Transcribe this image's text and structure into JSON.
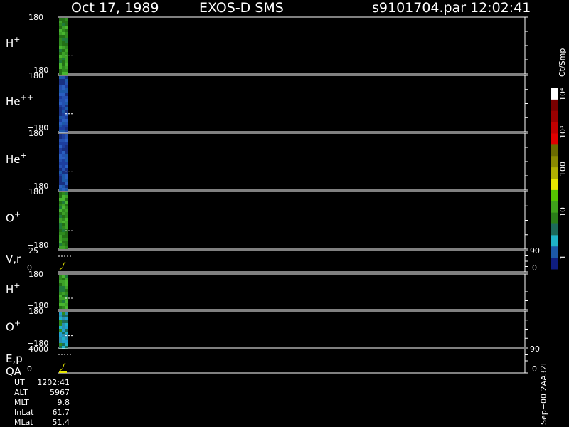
{
  "header": {
    "date": "Oct 17, 1989",
    "title": "EXOS-D SMS",
    "file": "s9101704.par",
    "time": "12:02:41"
  },
  "colors": {
    "background": "#000000",
    "frame": "#ffffff",
    "green": "#2e8a1e",
    "blue": "#1d3e9e",
    "cyan": "#1fb3c8",
    "yellow": "#e6e600"
  },
  "chart_data": {
    "type": "heatmap",
    "panels": [
      {
        "label": "H",
        "sup": "+",
        "tick_top": "180",
        "tick_bottom": "−180",
        "dominant": "green"
      },
      {
        "label": "He",
        "sup": "++",
        "tick_top": "180",
        "tick_bottom": "−180",
        "dominant": "blue"
      },
      {
        "label": "He",
        "sup": "+",
        "tick_top": "180",
        "tick_bottom": "−180",
        "dominant": "blue"
      },
      {
        "label": "O",
        "sup": "+",
        "tick_top": "180",
        "tick_bottom": "−180",
        "dominant": "green"
      },
      {
        "label": "V,r",
        "sup": "",
        "tick_top": "25",
        "tick_bottom": "0",
        "right_top": "90",
        "right_bottom": "0"
      },
      {
        "label": "H",
        "sup": "+",
        "tick_top": "180",
        "tick_bottom": "−180",
        "dominant": "green"
      },
      {
        "label": "O",
        "sup": "+",
        "tick_top": "180",
        "tick_bottom": "−180",
        "dominant": "cyan"
      },
      {
        "label": "E,p",
        "label2": "QA",
        "sup": "",
        "tick_top": "4000",
        "tick_bottom": "0",
        "right_top": "90",
        "right_bottom": "0"
      }
    ],
    "colorbar": {
      "unit": "Ct/Smp",
      "labels": [
        "10⁴",
        "10³",
        "100",
        "10",
        "1"
      ],
      "colors": [
        "#ffffff",
        "#7a0000",
        "#9a0000",
        "#c00000",
        "#e00000",
        "#6b6b00",
        "#8a8a00",
        "#b0b000",
        "#e6e600",
        "#55c400",
        "#3fa21a",
        "#2a7d18",
        "#1c6a5a",
        "#1fb3c8",
        "#1c58a8",
        "#0f1d80"
      ]
    }
  },
  "info": [
    {
      "label": "UT",
      "value": "1202:41"
    },
    {
      "label": "ALT",
      "value": "5967"
    },
    {
      "label": "MLT",
      "value": "9.8"
    },
    {
      "label": "InLat",
      "value": "61.7"
    },
    {
      "label": "MLat",
      "value": "51.4"
    }
  ],
  "footer": "Sep−00  2AA32L"
}
